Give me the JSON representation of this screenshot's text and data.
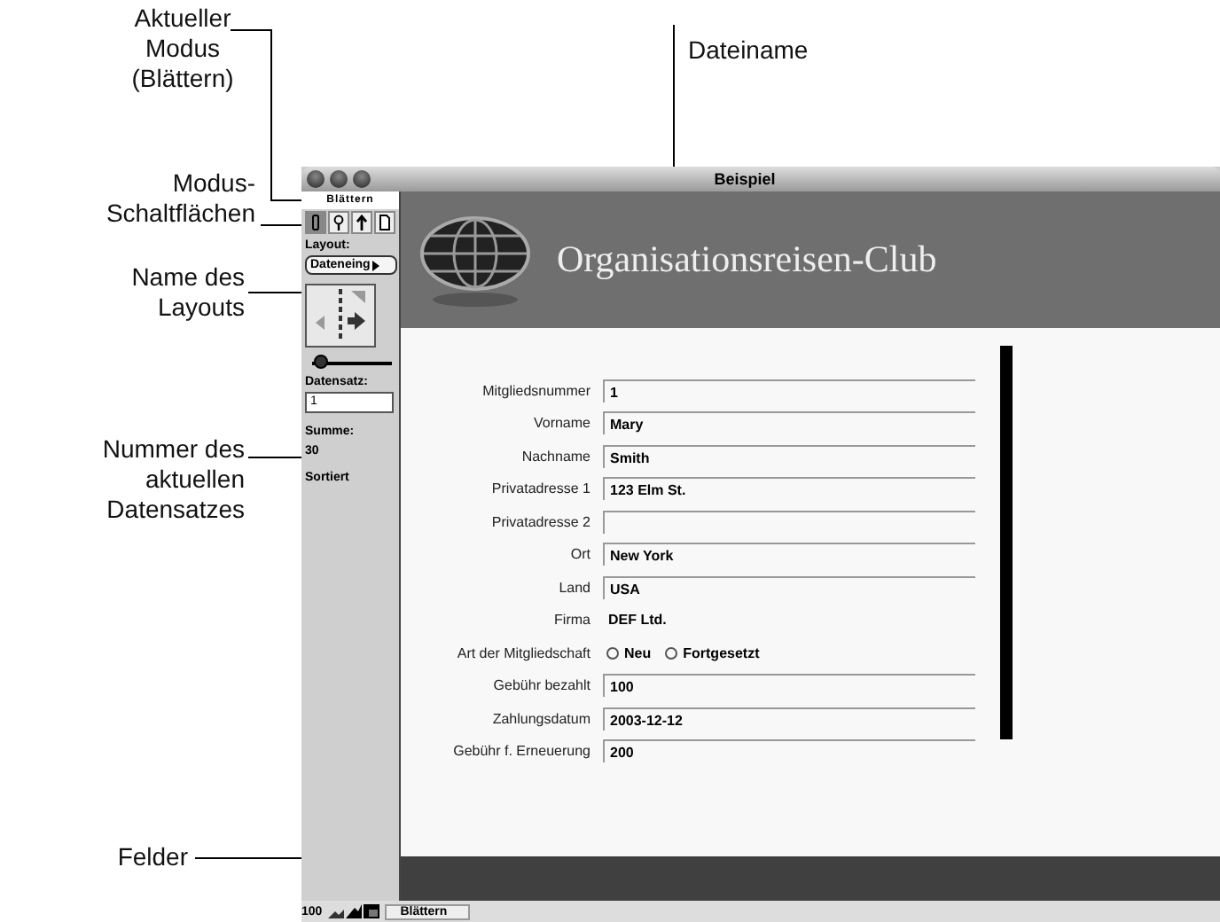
{
  "callouts": [
    {
      "kind": "mode",
      "text": "Aktueller Modus (Blättern)"
    },
    {
      "kind": "buttons",
      "text": "Modus-Schaltflächen"
    },
    {
      "kind": "layout",
      "text": "Name des Layouts"
    },
    {
      "kind": "record",
      "text": "Nummer des aktuellen Datensatzes"
    },
    {
      "kind": "fields",
      "text": "Felder"
    },
    {
      "kind": "filename",
      "text": "Dateiname"
    }
  ],
  "window": {
    "title": "Beispiel"
  },
  "sidebar": {
    "mode": "Blättern",
    "mode_buttons": [
      {
        "kind": "browse",
        "selected": true
      },
      {
        "kind": "find",
        "selected": false
      },
      {
        "kind": "layout",
        "selected": false
      },
      {
        "kind": "preview",
        "selected": false
      }
    ],
    "layout_label": "Layout:",
    "layout_name": "Dateneing",
    "slider": {
      "level": 0.1
    },
    "record_label": "Datensatz:",
    "record_number": "1",
    "total_label": "Summe:",
    "total": "30",
    "sort_state": "Sortiert"
  },
  "header": {
    "title": "Organisationsreisen-Club"
  },
  "form": [
    {
      "label": "Mitgliedsnummer",
      "kind": "field",
      "value": "1"
    },
    {
      "label": "Vorname",
      "kind": "field",
      "value": "Mary"
    },
    {
      "label": "Nachname",
      "kind": "field",
      "value": "Smith"
    },
    {
      "label": "Privatadresse 1",
      "kind": "field",
      "value": "123 Elm St."
    },
    {
      "label": "Privatadresse 2",
      "kind": "field"
    },
    {
      "label": "Ort",
      "kind": "field",
      "value": "New York"
    },
    {
      "label": "Land",
      "kind": "field",
      "value": "USA"
    },
    {
      "label": "Firma",
      "kind": "text",
      "value": "DEF Ltd."
    },
    {
      "label": "Art der Mitgliedschaft",
      "kind": "radio",
      "options": [
        {
          "label": "Neu",
          "selected": false
        },
        {
          "label": "Fortgesetzt",
          "selected": false
        }
      ]
    },
    {
      "label": "Gebühr bezahlt",
      "kind": "field",
      "value": "100"
    },
    {
      "label": "Zahlungsdatum",
      "kind": "field",
      "value": "2003-12-12"
    },
    {
      "label": "Gebühr f. Erneuerung",
      "kind": "field",
      "value": "200"
    }
  ],
  "status_bar": {
    "zoom": "100",
    "mode": "Blättern"
  }
}
